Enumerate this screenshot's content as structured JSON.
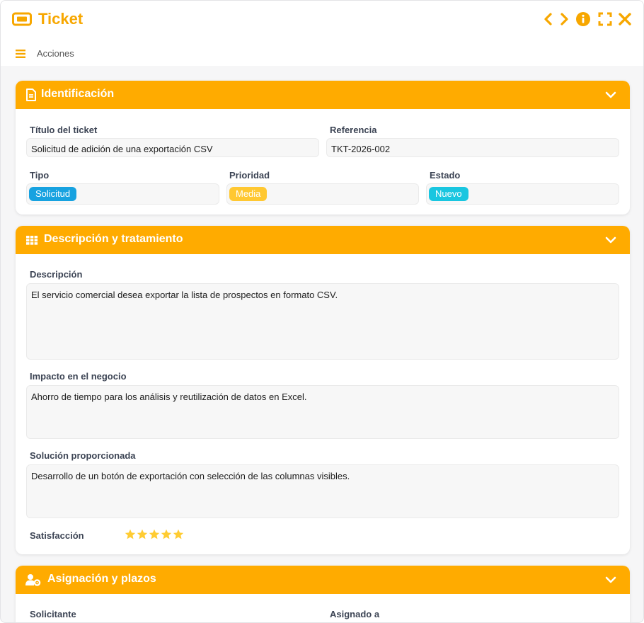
{
  "window": {
    "title": "Ticket"
  },
  "actions": {
    "label": "Acciones"
  },
  "colors": {
    "accent": "#ffab00",
    "title": "#f7a700",
    "badge_type": "#17a2e0",
    "badge_priority": "#ffc832",
    "badge_status": "#19c6e0",
    "star": "#ffcc33"
  },
  "icons": {
    "title": "ticket-icon",
    "prev": "chevron-left-icon",
    "next": "chevron-right-icon",
    "info": "info-icon",
    "fullscreen": "fullscreen-icon",
    "close": "close-icon",
    "menu": "hamburger-menu-icon",
    "identification": "document-icon",
    "description": "table-icon",
    "assignment": "user-gear-icon",
    "collapse": "chevron-down-icon"
  },
  "identification": {
    "title": "Identificación",
    "ticket_title_label": "Título del ticket",
    "ticket_title_value": "Solicitud de adición de una exportación CSV",
    "reference_label": "Referencia",
    "reference_value": "TKT-2026-002",
    "type_label": "Tipo",
    "type_value": "Solicitud",
    "priority_label": "Prioridad",
    "priority_value": "Media",
    "status_label": "Estado",
    "status_value": "Nuevo"
  },
  "description": {
    "title": "Descripción y tratamiento",
    "description_label": "Descripción",
    "description_value": "El servicio comercial desea exportar la lista de prospectos en formato CSV.",
    "impact_label": "Impacto en el negocio",
    "impact_value": "Ahorro de tiempo para los análisis y reutilización de datos en Excel.",
    "solution_label": "Solución proporcionada",
    "solution_value": "Desarrollo de un botón de exportación con selección de las columnas visibles.",
    "satisfaction_label": "Satisfacción",
    "satisfaction_rating": 5,
    "satisfaction_max": 5
  },
  "assignment": {
    "title": "Asignación y plazos",
    "requester_label": "Solicitante",
    "assigned_label": "Asignado a"
  }
}
